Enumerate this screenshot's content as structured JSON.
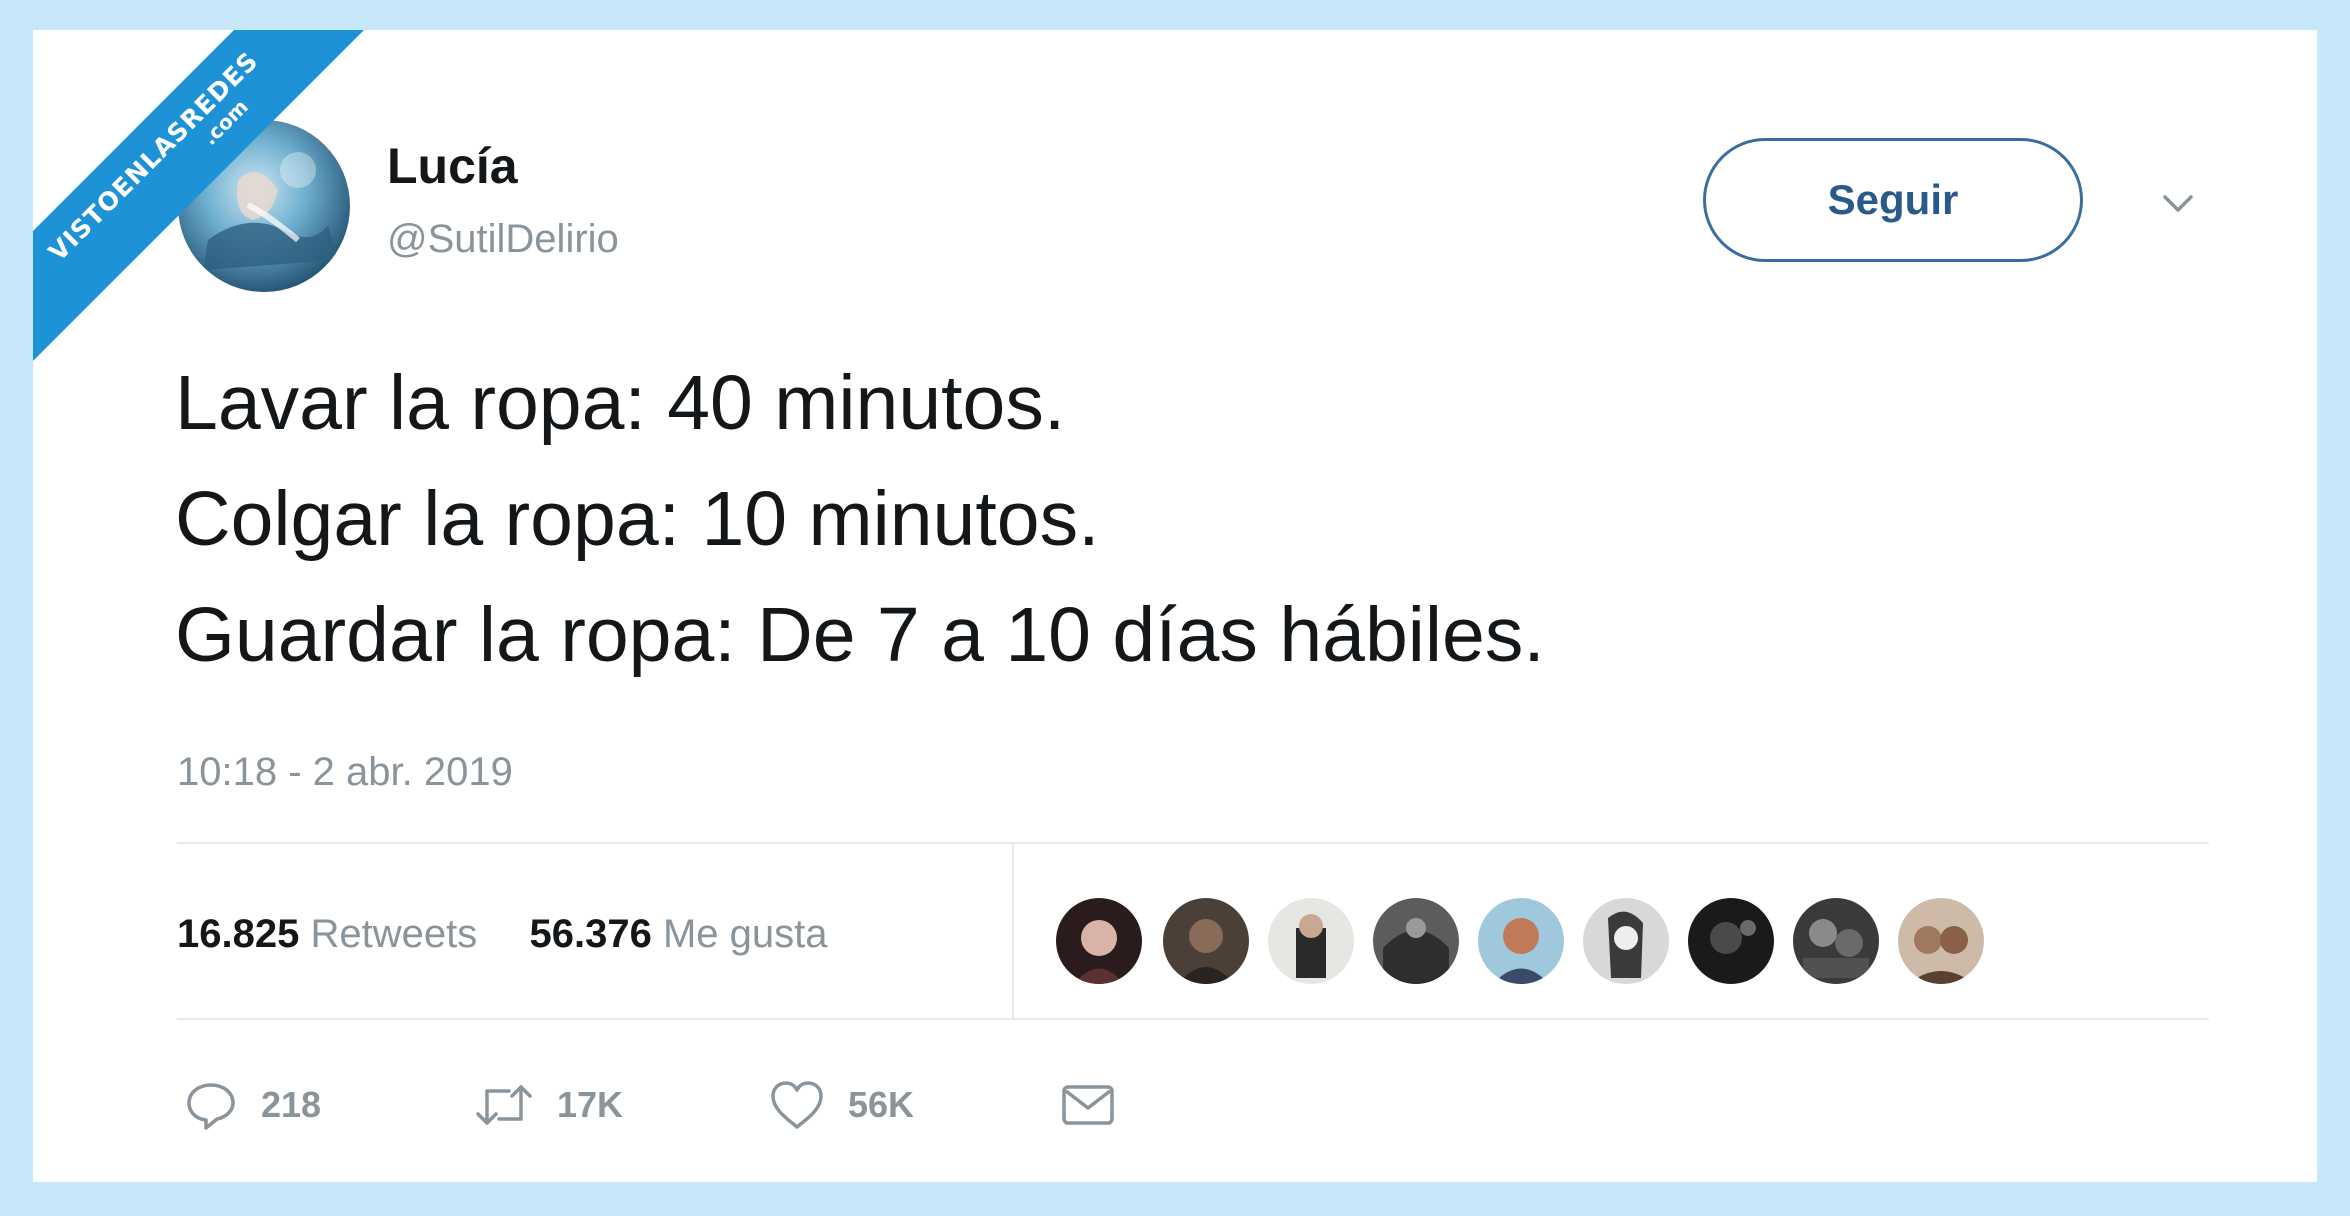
{
  "watermark": {
    "line1": "VISTOENLASREDES",
    "line2": ".com"
  },
  "author": {
    "name": "Lucía",
    "handle": "@SutilDelirio"
  },
  "follow_label": "Seguir",
  "tweet_lines": [
    "Lavar la ropa: 40 minutos.",
    "Colgar la ropa: 10 minutos.",
    "Guardar la ropa: De 7 a 10 días hábiles."
  ],
  "timestamp": "10:18 - 2 abr. 2019",
  "stats": {
    "retweets_count": "16.825",
    "retweets_label": "Retweets",
    "likes_count": "56.376",
    "likes_label": "Me gusta"
  },
  "actions": {
    "reply_count": "218",
    "retweet_count": "17K",
    "like_count": "56K"
  },
  "icons": {
    "reply": "reply-icon",
    "retweet": "retweet-icon",
    "like": "heart-icon",
    "dm": "envelope-icon",
    "menu": "chevron-down-icon"
  },
  "colors": {
    "background": "#c7e8f8",
    "watermark": "#1e92d6",
    "follow_border": "#3a6e9e",
    "text": "#14171a",
    "muted": "#8a949c"
  }
}
